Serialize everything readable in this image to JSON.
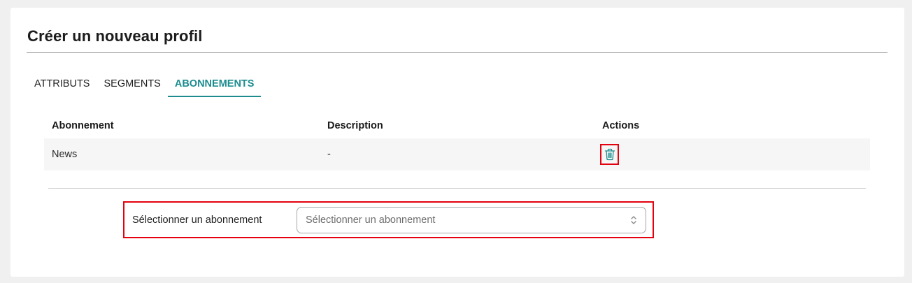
{
  "page": {
    "title": "Créer un nouveau profil"
  },
  "tabs": [
    {
      "label": "ATTRIBUTS",
      "active": false
    },
    {
      "label": "SEGMENTS",
      "active": false
    },
    {
      "label": "ABONNEMENTS",
      "active": true
    }
  ],
  "table": {
    "headers": {
      "subscription": "Abonnement",
      "description": "Description",
      "actions": "Actions"
    },
    "rows": [
      {
        "subscription": "News",
        "description": "-",
        "action_icon": "trash-icon"
      }
    ]
  },
  "subscription_select": {
    "label": "Sélectionner un abonnement",
    "placeholder": "Sélectionner un abonnement",
    "icon": "chevron-up-down-icon"
  },
  "colors": {
    "accent": "#1c8c8f",
    "highlight_border": "#e3000f",
    "row_background": "#f6f6f6",
    "page_background": "#f0f0f0"
  }
}
